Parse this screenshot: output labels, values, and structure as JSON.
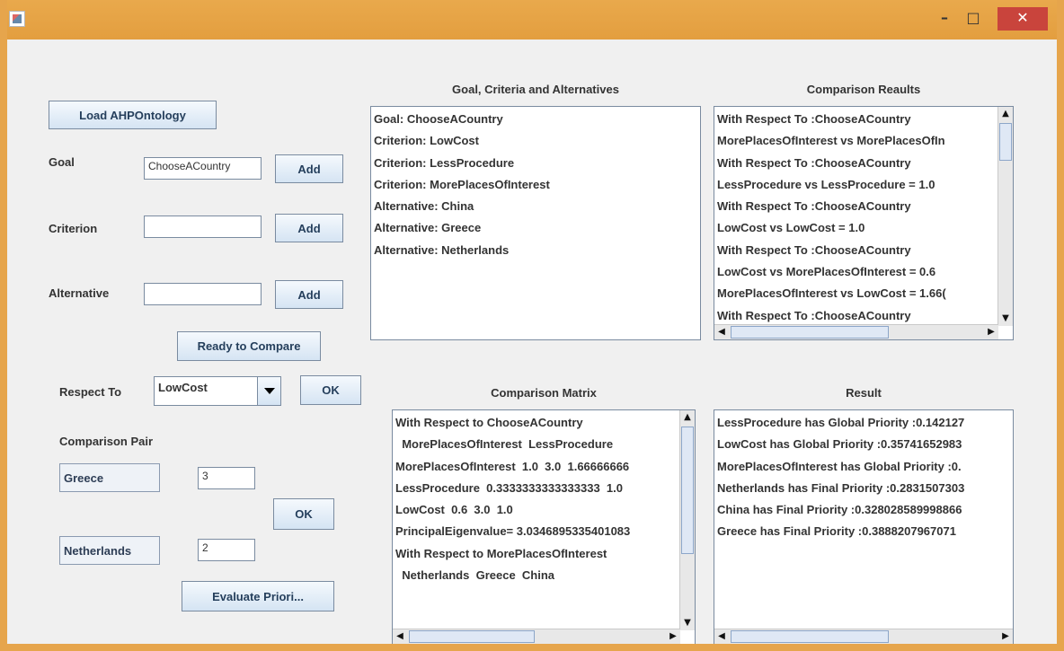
{
  "window": {
    "title": "",
    "minimize_glyph": "–",
    "maximize_glyph": "□",
    "close_glyph": "✕"
  },
  "left": {
    "load_button": "Load AHPOntology",
    "goal_label": "Goal",
    "goal_value": "ChooseACountry",
    "criterion_label": "Criterion",
    "criterion_value": "",
    "alternative_label": "Alternative",
    "alternative_value": "",
    "add_label": "Add",
    "ready_button": "Ready to Compare",
    "respect_label": "Respect To",
    "respect_selected": "LowCost",
    "ok_label": "OK",
    "comparison_pair_label": "Comparison Pair",
    "pair_first": "Greece",
    "pair_first_value": "3",
    "pair_second": "Netherlands",
    "pair_second_value": "2",
    "evaluate_button": "Evaluate Priori..."
  },
  "goal_panel": {
    "title": "Goal, Criteria and Alternatives",
    "lines": [
      "Goal: ChooseACountry",
      "Criterion: LowCost",
      "Criterion: LessProcedure",
      "Criterion: MorePlacesOfInterest",
      "Alternative: China",
      "Alternative: Greece",
      "Alternative: Netherlands"
    ]
  },
  "comparison_results": {
    "title": "Comparison Reaults",
    "lines": [
      "With Respect To :ChooseACountry",
      "MorePlacesOfInterest vs MorePlacesOfIn",
      "With Respect To :ChooseACountry",
      "LessProcedure vs LessProcedure = 1.0",
      "With Respect To :ChooseACountry",
      "LowCost vs LowCost = 1.0",
      "With Respect To :ChooseACountry",
      "LowCost vs MorePlacesOfInterest = 0.6",
      "MorePlacesOfInterest vs LowCost = 1.66(",
      "With Respect To :ChooseACountry"
    ]
  },
  "comparison_matrix": {
    "title": "Comparison Matrix",
    "lines": [
      "With Respect to ChooseACountry",
      "  MorePlacesOfInterest  LessProcedure",
      "MorePlacesOfInterest  1.0  3.0  1.66666666",
      "LessProcedure  0.3333333333333333  1.0",
      "LowCost  0.6  3.0  1.0",
      "PrincipalEigenvalue= 3.0346895335401083",
      "With Respect to MorePlacesOfInterest",
      "  Netherlands  Greece  China"
    ]
  },
  "result": {
    "title": "Result",
    "lines": [
      "LessProcedure has Global Priority :0.142127",
      "LowCost has Global Priority :0.35741652983",
      "MorePlacesOfInterest has Global Priority :0.",
      "Netherlands has Final Priority :0.2831507303",
      "China has Final Priority :0.328028589998866",
      "Greece has Final Priority :0.3888207967071"
    ]
  }
}
